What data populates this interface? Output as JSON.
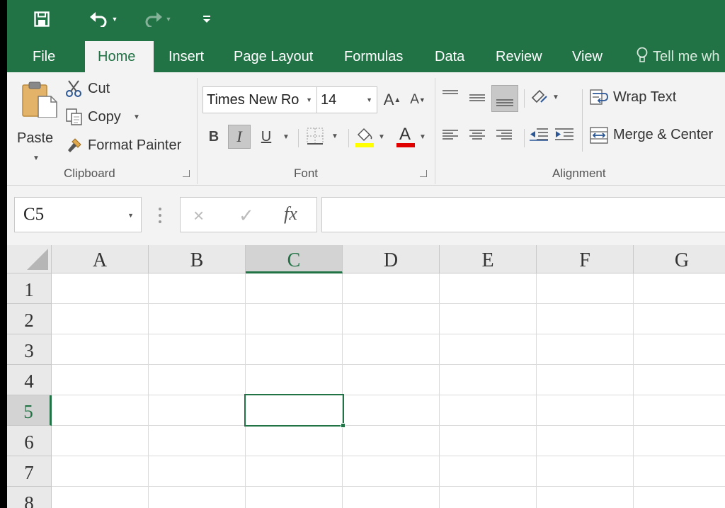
{
  "quick_access": {
    "save_icon": "save-icon",
    "undo_icon": "undo-icon",
    "redo_icon": "redo-icon",
    "customize_icon": "customize-qat-icon"
  },
  "tabs": [
    {
      "id": "file",
      "label": "File",
      "active": false
    },
    {
      "id": "home",
      "label": "Home",
      "active": true
    },
    {
      "id": "insert",
      "label": "Insert",
      "active": false
    },
    {
      "id": "page-layout",
      "label": "Page Layout",
      "active": false
    },
    {
      "id": "formulas",
      "label": "Formulas",
      "active": false
    },
    {
      "id": "data",
      "label": "Data",
      "active": false
    },
    {
      "id": "review",
      "label": "Review",
      "active": false
    },
    {
      "id": "view",
      "label": "View",
      "active": false
    }
  ],
  "tell_me": "Tell me wh",
  "clipboard": {
    "paste_label": "Paste",
    "cut_label": "Cut",
    "copy_label": "Copy",
    "format_painter_label": "Format Painter",
    "group_label": "Clipboard"
  },
  "font": {
    "font_name": "Times New Ro",
    "font_size": "14",
    "bold_label": "B",
    "italic_label": "I",
    "underline_label": "U",
    "font_color_label": "A",
    "grow_label": "A",
    "shrink_label": "A",
    "group_label": "Font",
    "italic_active": true,
    "fill_color": "#ffff00",
    "font_color": "#e00000"
  },
  "alignment": {
    "wrap_text_label": "Wrap Text",
    "merge_center_label": "Merge & Center",
    "group_label": "Alignment"
  },
  "formula_bar": {
    "name_box": "C5",
    "cancel_icon": "×",
    "enter_icon": "✓",
    "fx_label": "fx",
    "formula": ""
  },
  "sheet": {
    "columns": [
      "A",
      "B",
      "C",
      "D",
      "E",
      "F",
      "G"
    ],
    "rows": [
      "1",
      "2",
      "3",
      "4",
      "5",
      "6",
      "7",
      "8"
    ],
    "active_cell": "C5",
    "selected_column": "C",
    "selected_row": "5"
  },
  "colors": {
    "brand": "#217346",
    "ribbon_bg": "#f3f3f3"
  }
}
